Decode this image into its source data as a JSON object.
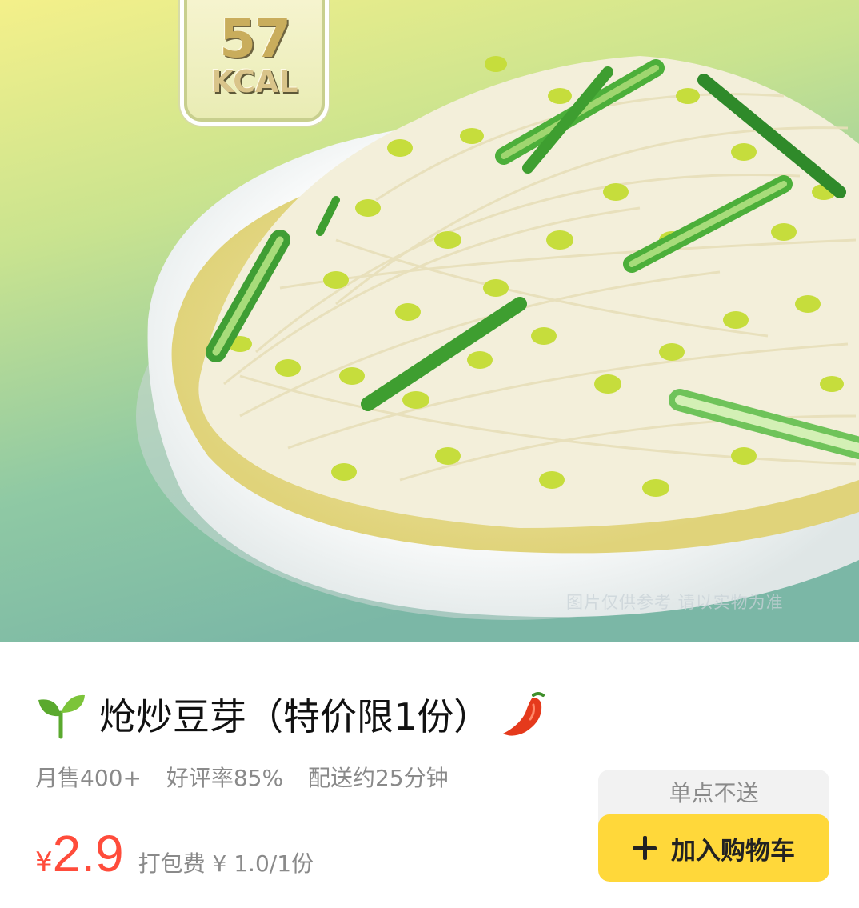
{
  "hero": {
    "kcal_value": "57",
    "kcal_unit": "KCAL",
    "watermark": "图片仅供参考 请以实物为准"
  },
  "product": {
    "leading_icon": "sprout-icon",
    "name": "炝炒豆芽（特价限1份）",
    "trailing_icon": "chili-pepper-icon",
    "monthly_sales": "月售400+",
    "rating": "好评率85%",
    "delivery": "配送约25分钟",
    "currency": "¥",
    "price": "2.9",
    "packing_fee": "打包费 ¥ 1.0/1份"
  },
  "cart": {
    "note": "单点不送",
    "add_label": "加入购物车",
    "add_icon": "plus-icon"
  },
  "colors": {
    "price": "#ff4c3b",
    "button": "#ffd83a",
    "muted_text": "#8a8a8a"
  }
}
